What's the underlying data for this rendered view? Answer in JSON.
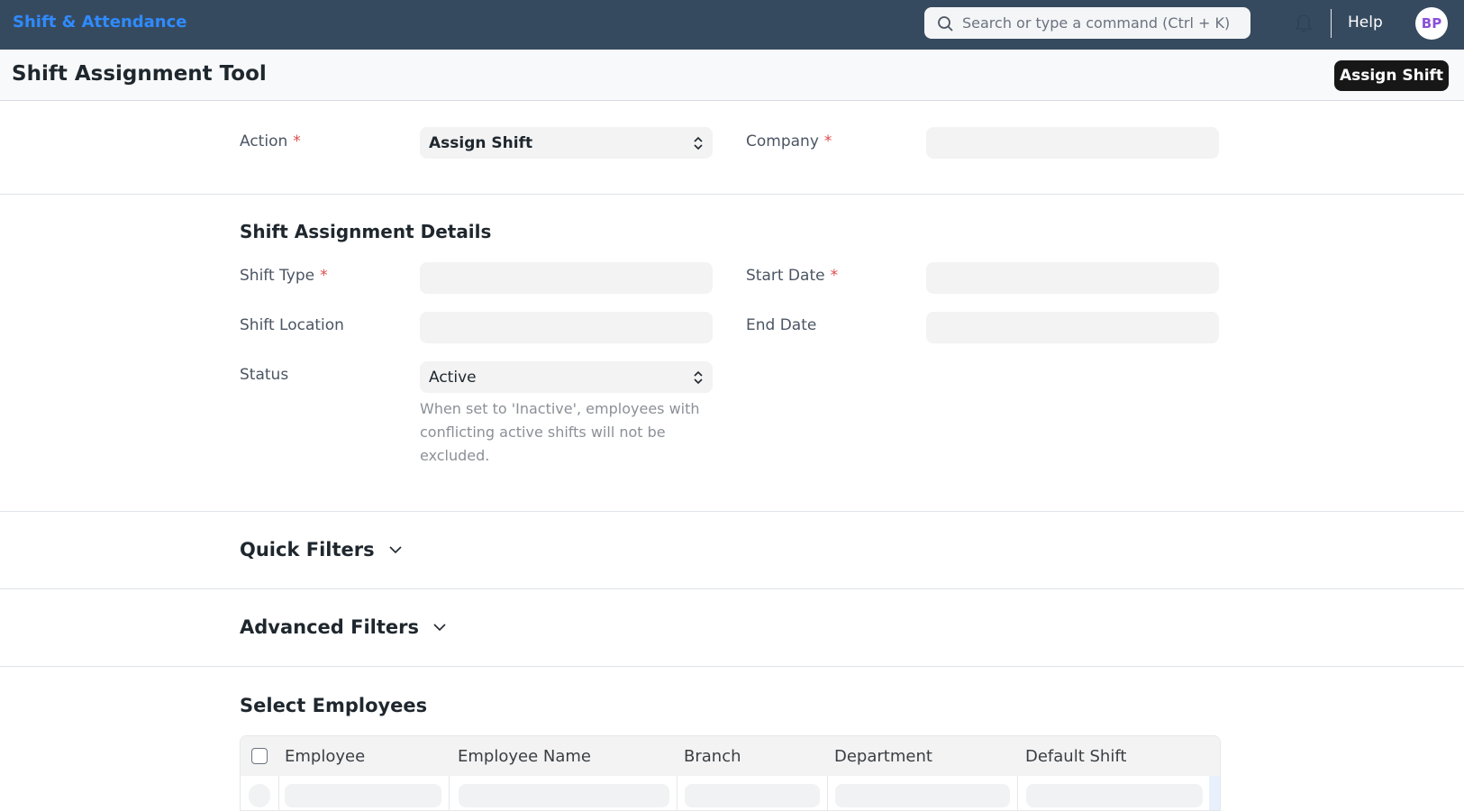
{
  "navbar": {
    "brand": "Shift & Attendance",
    "search_placeholder": "Search or type a command (Ctrl + K)",
    "help": "Help",
    "avatar_initials": "BP"
  },
  "page": {
    "title": "Shift Assignment Tool",
    "primary_action": "Assign Shift"
  },
  "form": {
    "action_label": "Action",
    "action_value": "Assign Shift",
    "company_label": "Company",
    "company_value": "",
    "details_title": "Shift Assignment Details",
    "shift_type_label": "Shift Type",
    "shift_type_value": "",
    "start_date_label": "Start Date",
    "start_date_value": "",
    "shift_location_label": "Shift Location",
    "shift_location_value": "",
    "end_date_label": "End Date",
    "end_date_value": "",
    "status_label": "Status",
    "status_value": "Active",
    "status_description": "When set to 'Inactive', employees with conflicting active shifts will not be excluded.",
    "required_marker": "*"
  },
  "sections": {
    "quick_filters": "Quick Filters",
    "advanced_filters": "Advanced Filters",
    "select_employees": "Select Employees"
  },
  "table": {
    "columns": [
      "Employee",
      "Employee Name",
      "Branch",
      "Department",
      "Default Shift"
    ]
  },
  "colors": {
    "navbar_bg": "#364a5f",
    "brand": "#2f8bff",
    "primary_button": "#171717",
    "required": "#e24c4c",
    "avatar_text": "#8b4fd9"
  },
  "icons": {
    "search": "search-icon",
    "notification": "bell-icon",
    "select": "up-down-chevron-icon",
    "collapse": "chevron-down-icon"
  }
}
